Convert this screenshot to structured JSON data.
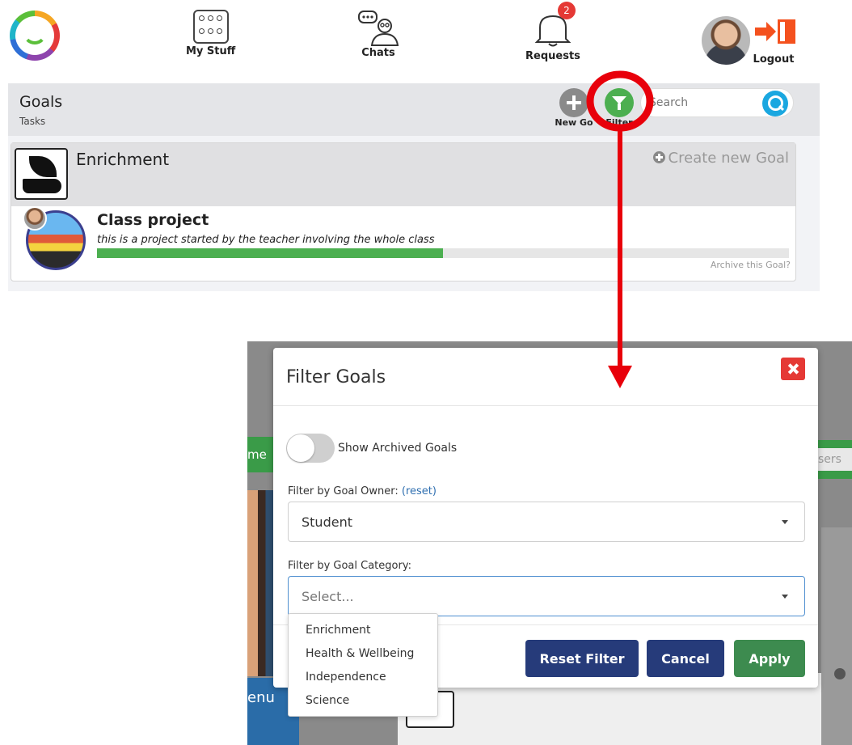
{
  "nav": {
    "my_stuff": "My Stuff",
    "chats": "Chats",
    "requests": "Requests",
    "requests_badge": "2",
    "logout": "Logout"
  },
  "toolbar": {
    "title": "Goals",
    "subtitle": "Tasks",
    "new_goal_label": "New Go",
    "filter_label": "Filter",
    "search_placeholder": "Search"
  },
  "category": {
    "title": "Enrichment",
    "create_label": "Create new Goal",
    "goal": {
      "title": "Class project",
      "description": "this is a project started by the teacher involving the whole class",
      "progress_percent": 50,
      "archive_label": "Archive this Goal?"
    }
  },
  "background": {
    "left_tab_text": "me",
    "right_tab_text": "sers",
    "menu_text": "enu"
  },
  "modal": {
    "title": "Filter Goals",
    "toggle_label": "Show Archived Goals",
    "toggle_on": false,
    "owner_label": "Filter by Goal Owner:",
    "owner_reset": "(reset)",
    "owner_value": "Student",
    "category_label": "Filter by Goal Category:",
    "category_placeholder": "Select...",
    "category_options": [
      "Enrichment",
      "Health & Wellbeing",
      "Independence",
      "Science"
    ],
    "buttons": {
      "reset": "Reset Filter",
      "cancel": "Cancel",
      "apply": "Apply"
    }
  },
  "colors": {
    "annotation": "#e8000b",
    "primary_button": "#263b7a",
    "apply_button": "#3d8b4f",
    "progress": "#4caf50"
  }
}
